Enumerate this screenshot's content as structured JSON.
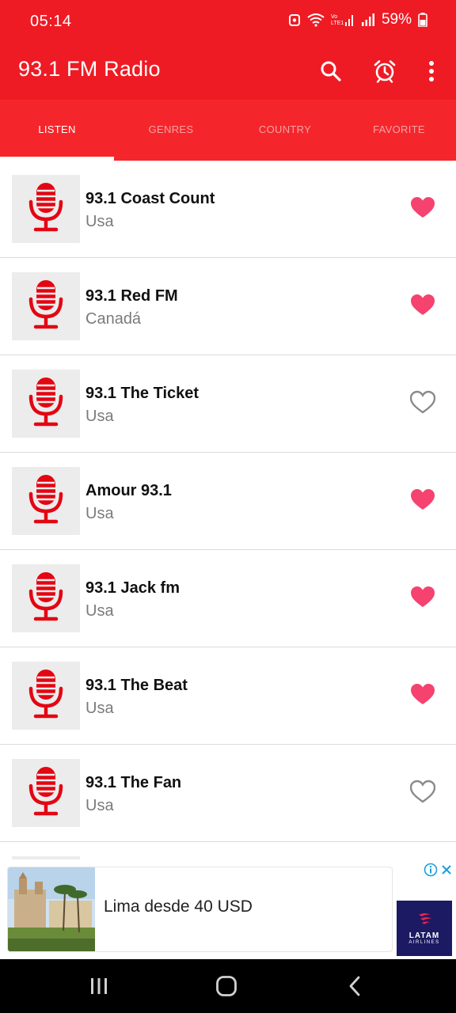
{
  "status": {
    "time": "05:14",
    "battery": "59%"
  },
  "appbar": {
    "title": "93.1 FM Radio"
  },
  "tabs": [
    {
      "label": "LISTEN",
      "active": true
    },
    {
      "label": "GENRES",
      "active": false
    },
    {
      "label": "COUNTRY",
      "active": false
    },
    {
      "label": "FAVORITE",
      "active": false
    }
  ],
  "stations": [
    {
      "name": "93.1 Coast Count",
      "country": "Usa",
      "favorite": true
    },
    {
      "name": "93.1 Red FM",
      "country": "Canadá",
      "favorite": true
    },
    {
      "name": "93.1 The Ticket",
      "country": "Usa",
      "favorite": false
    },
    {
      "name": "Amour 93.1",
      "country": "Usa",
      "favorite": true
    },
    {
      "name": "93.1 Jack fm",
      "country": "Usa",
      "favorite": true
    },
    {
      "name": "93.1 The Beat",
      "country": "Usa",
      "favorite": true
    },
    {
      "name": "93.1 The Fan",
      "country": "Usa",
      "favorite": false
    }
  ],
  "ad": {
    "text": "Lima desde 40 USD",
    "brand": "LATAM",
    "brand_sub": "AIRLINES"
  },
  "colors": {
    "primary": "#ee1b24",
    "heart_filled": "#f5426f",
    "heart_outline": "#8a8a8a",
    "mic": "#e30613"
  }
}
